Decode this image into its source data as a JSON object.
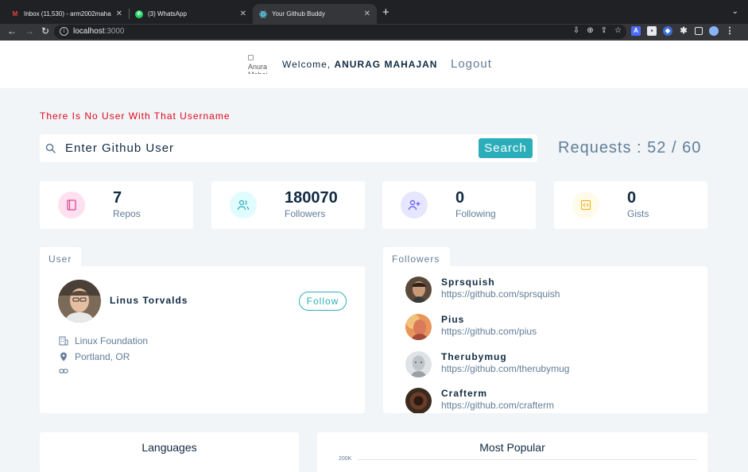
{
  "browser": {
    "tabs": [
      {
        "title": "Inbox (11,530) - arm2002maha",
        "favicon": "gmail-icon",
        "active": false
      },
      {
        "title": "(3) WhatsApp",
        "favicon": "whatsapp-icon",
        "active": false
      },
      {
        "title": "Your Github Buddy",
        "favicon": "react-icon",
        "active": true
      }
    ],
    "url_host": "localhost",
    "url_port": ":3000"
  },
  "header": {
    "avatar_alt": "Anurag Mahajan",
    "welcome_prefix": "Welcome, ",
    "user_name": "ANURAG MAHAJAN",
    "logout_label": "Logout"
  },
  "search": {
    "error": "There Is No User With That Username",
    "placeholder": "Enter Github User",
    "value": "",
    "button_label": "Search",
    "requests_label": "Requests : 52 / 60"
  },
  "stats": [
    {
      "value": "7",
      "label": "Repos",
      "icon": "book-icon",
      "bg": "#ffe0f0",
      "fg": "#da4a91"
    },
    {
      "value": "180070",
      "label": "Followers",
      "icon": "users-icon",
      "bg": "#e0fcff",
      "fg": "#2caeba"
    },
    {
      "value": "0",
      "label": "Following",
      "icon": "user-plus-icon",
      "bg": "#e6e6ff",
      "fg": "#5d55fa"
    },
    {
      "value": "0",
      "label": "Gists",
      "icon": "code-icon",
      "bg": "#fffbea",
      "fg": "#f0b429"
    }
  ],
  "user_card": {
    "tab_label": "User",
    "name": "Linus Torvalds",
    "follow_label": "Follow",
    "company": "Linux Foundation",
    "location": "Portland, OR",
    "blog": ""
  },
  "followers_card": {
    "tab_label": "Followers",
    "items": [
      {
        "name": "Sprsquish",
        "url": "https://github.com/sprsquish"
      },
      {
        "name": "Pius",
        "url": "https://github.com/pius"
      },
      {
        "name": "Therubymug",
        "url": "https://github.com/therubymug"
      },
      {
        "name": "Crafterm",
        "url": "https://github.com/crafterm"
      }
    ]
  },
  "charts": {
    "languages_title": "Languages",
    "popular_title": "Most Popular",
    "popular_axis_tick": "200K"
  },
  "colors": {
    "primary": "#2caeba",
    "text_dark": "#102a42",
    "text_muted": "#617d98",
    "error": "#e1061b",
    "background": "#f1f5f8"
  }
}
